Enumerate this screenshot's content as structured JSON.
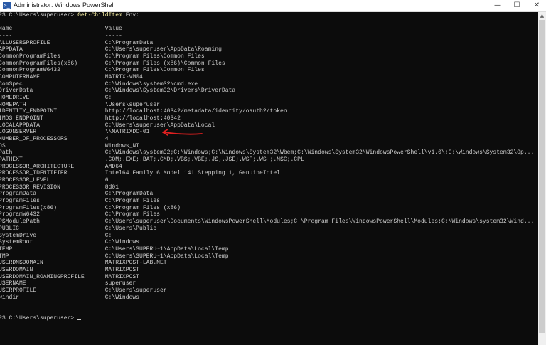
{
  "window": {
    "title": "Administrator: Windows PowerShell",
    "minimize_glyph": "—",
    "maximize_glyph": "☐",
    "close_glyph": "✕"
  },
  "terminal": {
    "prompt": "PS C:\\Users\\superuser> ",
    "command": "Get-ChildItem",
    "argument": " Env:",
    "header": {
      "name": "Name",
      "value": "Value"
    },
    "separator": {
      "name": "----",
      "value": "-----"
    },
    "rows": [
      {
        "name": "ALLUSERSPROFILE",
        "value": "C:\\ProgramData"
      },
      {
        "name": "APPDATA",
        "value": "C:\\Users\\superuser\\AppData\\Roaming"
      },
      {
        "name": "CommonProgramFiles",
        "value": "C:\\Program Files\\Common Files"
      },
      {
        "name": "CommonProgramFiles(x86)",
        "value": "C:\\Program Files (x86)\\Common Files"
      },
      {
        "name": "CommonProgramW6432",
        "value": "C:\\Program Files\\Common Files"
      },
      {
        "name": "COMPUTERNAME",
        "value": "MATRIX-VM04"
      },
      {
        "name": "ComSpec",
        "value": "C:\\Windows\\system32\\cmd.exe"
      },
      {
        "name": "DriverData",
        "value": "C:\\Windows\\System32\\Drivers\\DriverData"
      },
      {
        "name": "HOMEDRIVE",
        "value": "C:"
      },
      {
        "name": "HOMEPATH",
        "value": "\\Users\\superuser"
      },
      {
        "name": "IDENTITY_ENDPOINT",
        "value": "http://localhost:40342/metadata/identity/oauth2/token"
      },
      {
        "name": "IMDS_ENDPOINT",
        "value": "http://localhost:40342"
      },
      {
        "name": "LOCALAPPDATA",
        "value": "C:\\Users\\superuser\\AppData\\Local"
      },
      {
        "name": "LOGONSERVER",
        "value": "\\\\MATRIXDC-01"
      },
      {
        "name": "NUMBER_OF_PROCESSORS",
        "value": "4"
      },
      {
        "name": "OS",
        "value": "Windows_NT"
      },
      {
        "name": "Path",
        "value": "C:\\Windows\\system32;C:\\Windows;C:\\Windows\\System32\\Wbem;C:\\Windows\\System32\\WindowsPowerShell\\v1.0\\;C:\\Windows\\System32\\Op..."
      },
      {
        "name": "PATHEXT",
        "value": ".COM;.EXE;.BAT;.CMD;.VBS;.VBE;.JS;.JSE;.WSF;.WSH;.MSC;.CPL"
      },
      {
        "name": "PROCESSOR_ARCHITECTURE",
        "value": "AMD64"
      },
      {
        "name": "PROCESSOR_IDENTIFIER",
        "value": "Intel64 Family 6 Model 141 Stepping 1, GenuineIntel"
      },
      {
        "name": "PROCESSOR_LEVEL",
        "value": "6"
      },
      {
        "name": "PROCESSOR_REVISION",
        "value": "8d01"
      },
      {
        "name": "ProgramData",
        "value": "C:\\ProgramData"
      },
      {
        "name": "ProgramFiles",
        "value": "C:\\Program Files"
      },
      {
        "name": "ProgramFiles(x86)",
        "value": "C:\\Program Files (x86)"
      },
      {
        "name": "ProgramW6432",
        "value": "C:\\Program Files"
      },
      {
        "name": "PSModulePath",
        "value": "C:\\Users\\superuser\\Documents\\WindowsPowerShell\\Modules;C:\\Program Files\\WindowsPowerShell\\Modules;C:\\Windows\\system32\\Wind..."
      },
      {
        "name": "PUBLIC",
        "value": "C:\\Users\\Public"
      },
      {
        "name": "SystemDrive",
        "value": "C:"
      },
      {
        "name": "SystemRoot",
        "value": "C:\\Windows"
      },
      {
        "name": "TEMP",
        "value": "C:\\Users\\SUPERU~1\\AppData\\Local\\Temp"
      },
      {
        "name": "TMP",
        "value": "C:\\Users\\SUPERU~1\\AppData\\Local\\Temp"
      },
      {
        "name": "USERDNSDOMAIN",
        "value": "MATRIXPOST-LAB.NET"
      },
      {
        "name": "USERDOMAIN",
        "value": "MATRIXPOST"
      },
      {
        "name": "USERDOMAIN_ROAMINGPROFILE",
        "value": "MATRIXPOST"
      },
      {
        "name": "USERNAME",
        "value": "superuser"
      },
      {
        "name": "USERPROFILE",
        "value": "C:\\Users\\superuser"
      },
      {
        "name": "windir",
        "value": "C:\\Windows"
      }
    ],
    "final_prompt": "PS C:\\Users\\superuser> "
  },
  "annotation_color": "#e02020",
  "colors": {
    "background": "#0c0c0c",
    "text": "#cccccc",
    "command": "#f9f1a5"
  }
}
